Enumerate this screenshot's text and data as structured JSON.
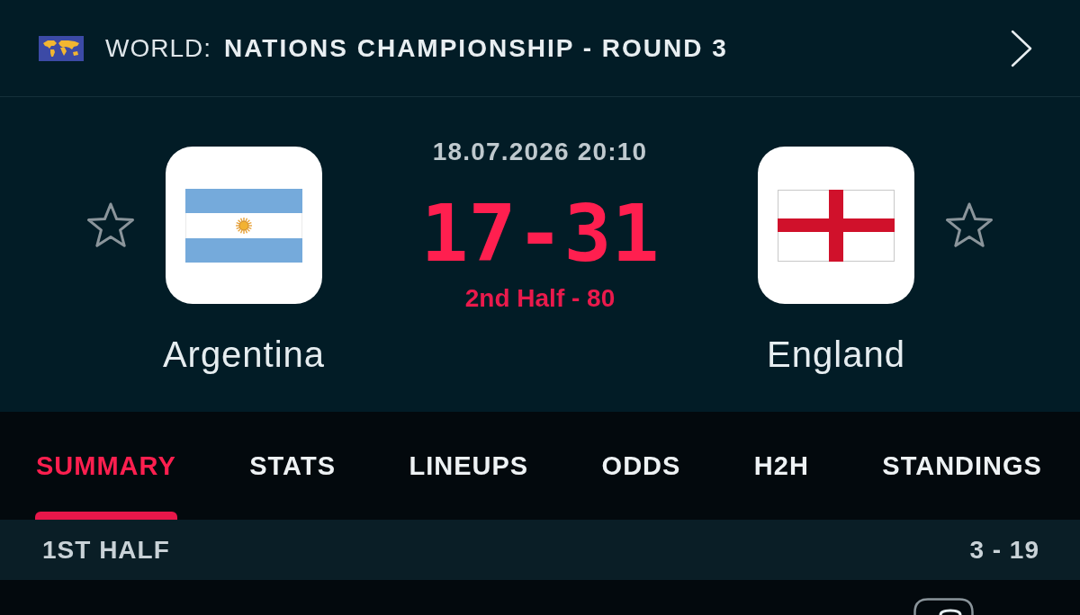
{
  "header": {
    "region": "WORLD:",
    "competition": "NATIONS CHAMPIONSHIP - ROUND 3"
  },
  "match": {
    "datetime": "18.07.2026 20:10",
    "score": "17-31",
    "status": "2nd Half - 80",
    "home": {
      "name": "Argentina",
      "favorite": false
    },
    "away": {
      "name": "England",
      "favorite": false
    }
  },
  "tabs": [
    {
      "label": "SUMMARY",
      "selected": true
    },
    {
      "label": "STATS",
      "selected": false
    },
    {
      "label": "LINEUPS",
      "selected": false
    },
    {
      "label": "ODDS",
      "selected": false
    },
    {
      "label": "H2H",
      "selected": false
    },
    {
      "label": "STANDINGS",
      "selected": false
    }
  ],
  "sections": [
    {
      "title": "1ST HALF",
      "score": "3 - 19"
    }
  ]
}
